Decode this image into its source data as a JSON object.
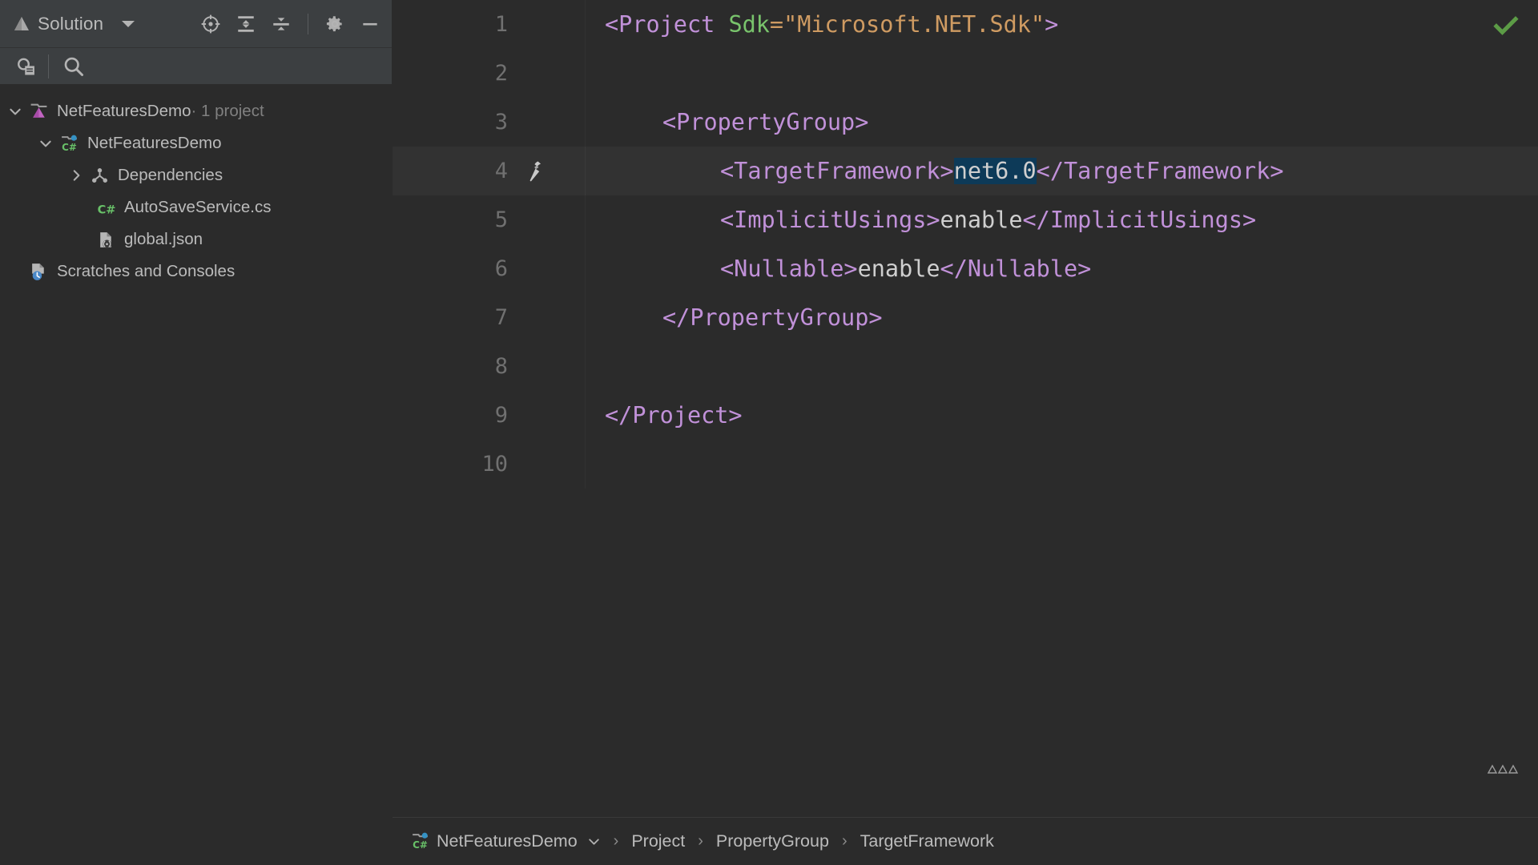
{
  "sidebar": {
    "title": "Solution",
    "title_icon": "solution-icon",
    "toolbar": [
      {
        "name": "locate-in-solution-icon",
        "label": "Locate in Solution"
      },
      {
        "name": "expand-all-icon",
        "label": "Expand All"
      },
      {
        "name": "collapse-all-icon",
        "label": "Collapse All"
      },
      {
        "name": "settings-gear-icon",
        "label": "Options"
      },
      {
        "name": "hide-icon",
        "label": "Hide"
      }
    ],
    "search": {
      "view_mode_icon": "solution-view-icon",
      "search_icon": "search-icon",
      "placeholder": ""
    },
    "tree": [
      {
        "label": "NetFeaturesDemo",
        "suffix": " · 1 project",
        "icon": "solution-node-icon",
        "twisty": "expanded",
        "indent": 1
      },
      {
        "label": "NetFeaturesDemo",
        "suffix": "",
        "icon": "csharp-project-icon",
        "twisty": "expanded",
        "indent": 2
      },
      {
        "label": "Dependencies",
        "suffix": "",
        "icon": "dependencies-icon",
        "twisty": "collapsed",
        "indent": 3
      },
      {
        "label": "AutoSaveService.cs",
        "suffix": "",
        "icon": "csharp-file-icon",
        "twisty": "none",
        "indent": 4
      },
      {
        "label": "global.json",
        "suffix": "",
        "icon": "json-file-icon",
        "twisty": "none",
        "indent": 4
      },
      {
        "label": "Scratches and Consoles",
        "suffix": "",
        "icon": "scratches-icon",
        "twisty": "collapsed-hidden",
        "indent": 1
      }
    ]
  },
  "editor": {
    "status_icon": "inspection-ok-check",
    "status_color": "#5c9c46",
    "current_line": 4,
    "lines": [
      {
        "num": "1",
        "gutter_icon": "none",
        "tokens": [
          {
            "t": "tag",
            "v": "<Project "
          },
          {
            "t": "attr",
            "v": "Sdk"
          },
          {
            "t": "val",
            "v": "=\"Microsoft.NET.Sdk\""
          },
          {
            "t": "tag",
            "v": ">"
          }
        ],
        "indent": 0
      },
      {
        "num": "2",
        "gutter_icon": "none",
        "tokens": [],
        "indent": 0
      },
      {
        "num": "3",
        "gutter_icon": "none",
        "tokens": [
          {
            "t": "tag",
            "v": "<PropertyGroup>"
          }
        ],
        "indent": 1
      },
      {
        "num": "4",
        "gutter_icon": "build-hammer-icon",
        "tokens": [
          {
            "t": "tag",
            "v": "<TargetFramework>"
          },
          {
            "t": "sel",
            "v": "net6.0"
          },
          {
            "t": "tag",
            "v": "</TargetFramework>"
          }
        ],
        "indent": 2
      },
      {
        "num": "5",
        "gutter_icon": "none",
        "tokens": [
          {
            "t": "tag",
            "v": "<ImplicitUsings>"
          },
          {
            "t": "txt",
            "v": "enable"
          },
          {
            "t": "tag",
            "v": "</ImplicitUsings>"
          }
        ],
        "indent": 2
      },
      {
        "num": "6",
        "gutter_icon": "none",
        "tokens": [
          {
            "t": "tag",
            "v": "<Nullable>"
          },
          {
            "t": "txt",
            "v": "enable"
          },
          {
            "t": "tag",
            "v": "</Nullable>"
          }
        ],
        "indent": 2
      },
      {
        "num": "7",
        "gutter_icon": "none",
        "tokens": [
          {
            "t": "tag",
            "v": "</PropertyGroup>"
          }
        ],
        "indent": 1
      },
      {
        "num": "8",
        "gutter_icon": "none",
        "tokens": [],
        "indent": 0
      },
      {
        "num": "9",
        "gutter_icon": "none",
        "tokens": [
          {
            "t": "tag",
            "v": "</Project>"
          }
        ],
        "indent": 0
      },
      {
        "num": "10",
        "gutter_icon": "none",
        "tokens": [],
        "indent": 0
      }
    ]
  },
  "breadcrumb": {
    "file": {
      "label": "NetFeaturesDemo",
      "icon": "csharp-project-icon"
    },
    "items": [
      "Project",
      "PropertyGroup",
      "TargetFramework"
    ],
    "separator": "›"
  },
  "colors": {
    "background": "#2b2b2b",
    "panel": "#3c3f41",
    "text": "#bbbbbb",
    "tag": "#c191d9",
    "attribute": "#79c46c",
    "value": "#cf9b62",
    "selection": "#0d3a58",
    "current_line": "#323232",
    "check_green": "#5c9c46",
    "csharp_green": "#68c068",
    "accent_blue": "#3592c4",
    "project_magenta": "#cc66cc"
  }
}
